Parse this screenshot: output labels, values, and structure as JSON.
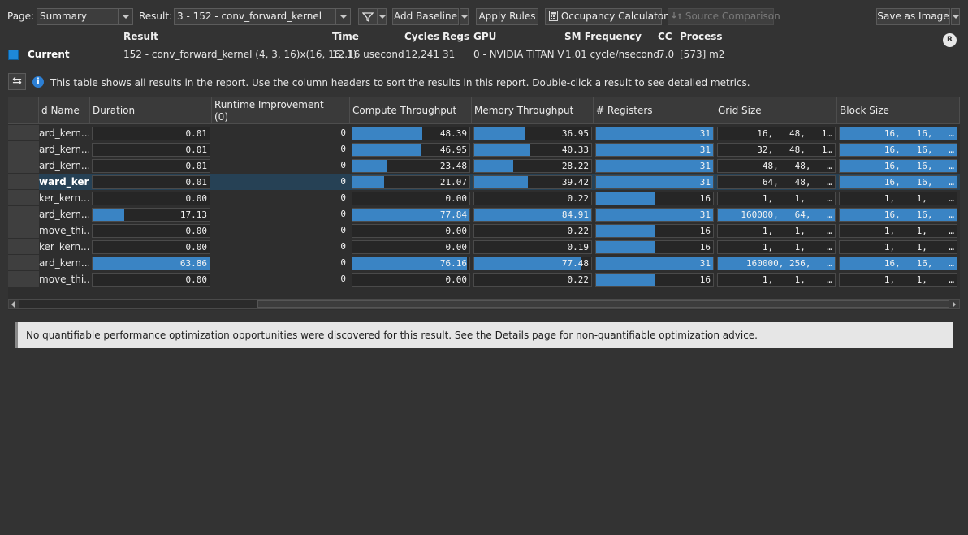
{
  "toolbar": {
    "page_label": "Page:",
    "page_value": "Summary",
    "result_label": "Result:",
    "result_value": "3 -  152 - conv_forward_kernel",
    "add_baseline": "Add Baseline",
    "apply_rules": "Apply Rules",
    "occupancy_calculator": "Occupancy Calculator",
    "source_comparison": "Source Comparison",
    "save_as_image": "Save as Image"
  },
  "result_header": {
    "headers": {
      "result": "Result",
      "time": "Time",
      "cycles": "Cycles",
      "regs": "Regs",
      "gpu": "GPU",
      "sm_frequency": "SM Frequency",
      "cc": "CC",
      "process": "Process"
    },
    "current": {
      "label": "Current",
      "color": "#1e88d9",
      "result": "152 - conv_forward_kernel (4, 3, 16)x(16, 16, 1)",
      "time": "12.16 usecond",
      "cycles": "12,241",
      "regs": "31",
      "gpu": "0 - NVIDIA TITAN V",
      "sm_frequency": "1.01 cycle/nsecond",
      "cc": "7.0",
      "process": "[573] m2"
    },
    "badge": "R"
  },
  "info": {
    "text": "This table shows all results in the report. Use the column headers to sort the results in this report. Double-click a result to see detailed metrics."
  },
  "table": {
    "columns": {
      "name": "Name",
      "duration": "Duration",
      "runtime_improvement_1": "Runtime Improvement",
      "runtime_improvement_2": "(0)",
      "compute": "Compute Throughput",
      "memory": "Memory Throughput",
      "registers": "# Registers",
      "grid": "Grid Size",
      "block": "Block Size"
    },
    "name_header_prefix": "d",
    "rows": [
      {
        "name": "ard_kern...",
        "duration": "0.01",
        "dur_frac": 0.0,
        "runtime": "0",
        "compute": "48.39",
        "compute_frac": 0.6,
        "memory": "36.95",
        "memory_frac": 0.44,
        "regs": "31",
        "regs_frac": 1.0,
        "grid": "16,   48,   1…",
        "grid_hl": false,
        "block": "16,   16,   …",
        "block_hl": true
      },
      {
        "name": "ard_kern...",
        "duration": "0.01",
        "dur_frac": 0.0,
        "runtime": "0",
        "compute": "46.95",
        "compute_frac": 0.58,
        "memory": "40.33",
        "memory_frac": 0.48,
        "regs": "31",
        "regs_frac": 1.0,
        "grid": "32,   48,   1…",
        "grid_hl": false,
        "block": "16,   16,   …",
        "block_hl": true
      },
      {
        "name": "ard_kern...",
        "duration": "0.01",
        "dur_frac": 0.0,
        "runtime": "0",
        "compute": "23.48",
        "compute_frac": 0.3,
        "memory": "28.22",
        "memory_frac": 0.33,
        "regs": "31",
        "regs_frac": 1.0,
        "grid": "48,   48,   …",
        "grid_hl": false,
        "block": "16,   16,   …",
        "block_hl": true
      },
      {
        "name": "ward_ker...",
        "duration": "0.01",
        "dur_frac": 0.0,
        "runtime": "0",
        "compute": "21.07",
        "compute_frac": 0.27,
        "memory": "39.42",
        "memory_frac": 0.46,
        "regs": "31",
        "regs_frac": 1.0,
        "grid": "64,   48,   …",
        "grid_hl": false,
        "block": "16,   16,   …",
        "block_hl": true,
        "selected": true
      },
      {
        "name": "ker_kern...",
        "duration": "0.00",
        "dur_frac": 0.0,
        "runtime": "0",
        "compute": "0.00",
        "compute_frac": 0.0,
        "memory": "0.22",
        "memory_frac": 0.0,
        "regs": "16",
        "regs_frac": 0.51,
        "grid": "1,    1,    …",
        "grid_hl": false,
        "block": "1,    1,    …",
        "block_hl": false
      },
      {
        "name": "ard_kern...",
        "duration": "17.13",
        "dur_frac": 0.27,
        "runtime": "0",
        "compute": "77.84",
        "compute_frac": 1.0,
        "memory": "84.91",
        "memory_frac": 1.0,
        "regs": "31",
        "regs_frac": 1.0,
        "grid": "160000,   64,   …",
        "grid_hl": true,
        "block": "16,   16,   …",
        "block_hl": true
      },
      {
        "name": "move_thi...",
        "duration": "0.00",
        "dur_frac": 0.0,
        "runtime": "0",
        "compute": "0.00",
        "compute_frac": 0.0,
        "memory": "0.22",
        "memory_frac": 0.0,
        "regs": "16",
        "regs_frac": 0.51,
        "grid": "1,    1,    …",
        "grid_hl": false,
        "block": "1,    1,    …",
        "block_hl": false
      },
      {
        "name": "ker_kern...",
        "duration": "0.00",
        "dur_frac": 0.0,
        "runtime": "0",
        "compute": "0.00",
        "compute_frac": 0.0,
        "memory": "0.19",
        "memory_frac": 0.0,
        "regs": "16",
        "regs_frac": 0.51,
        "grid": "1,    1,    …",
        "grid_hl": false,
        "block": "1,    1,    …",
        "block_hl": false
      },
      {
        "name": "ard_kern...",
        "duration": "63.86",
        "dur_frac": 1.0,
        "runtime": "0",
        "compute": "76.16",
        "compute_frac": 0.98,
        "memory": "77.48",
        "memory_frac": 0.91,
        "regs": "31",
        "regs_frac": 1.0,
        "grid": "160000, 256,   …",
        "grid_hl": true,
        "block": "16,   16,   …",
        "block_hl": true
      },
      {
        "name": "move_thi...",
        "duration": "0.00",
        "dur_frac": 0.0,
        "runtime": "0",
        "compute": "0.00",
        "compute_frac": 0.0,
        "memory": "0.22",
        "memory_frac": 0.0,
        "regs": "16",
        "regs_frac": 0.51,
        "grid": "1,    1,    …",
        "grid_hl": false,
        "block": "1,    1,    …",
        "block_hl": false
      }
    ]
  },
  "message": "No quantifiable performance optimization opportunities were discovered for this result. See the Details page for non-quantifiable optimization advice.",
  "colors": {
    "background": "#333333",
    "bar": "#3a84c4",
    "accent": "#1e88d9",
    "selected_row": "#264155"
  },
  "icons": {
    "filter": "filter-icon",
    "calculator": "calculator-icon",
    "source_comparison": "source-comparison-icon",
    "swap": "swap-icon",
    "info": "info-icon"
  }
}
